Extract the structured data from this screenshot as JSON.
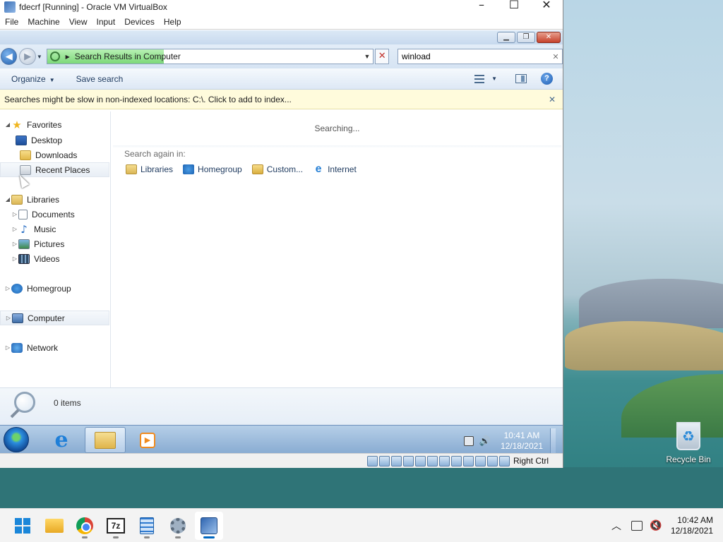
{
  "host": {
    "desktop": {
      "recycle_bin_label": "Recycle Bin"
    },
    "taskbar": {
      "apps": [
        "start-icon",
        "file-explorer-icon",
        "chrome-icon",
        "7zip-icon",
        "notepad-icon",
        "settings-icon",
        "virtualbox-icon"
      ],
      "tray": {
        "time": "10:42 AM",
        "date": "12/18/2021"
      }
    }
  },
  "vbox": {
    "title": "fdecrf [Running] - Oracle VM VirtualBox",
    "menu": [
      "File",
      "Machine",
      "View",
      "Input",
      "Devices",
      "Help"
    ],
    "status": {
      "host_key": "Right Ctrl"
    }
  },
  "explorer": {
    "address": {
      "location": "Search Results in Computer"
    },
    "search": {
      "value": "winload"
    },
    "commands": {
      "organize": "Organize",
      "save_search": "Save search"
    },
    "infobar": {
      "message": "Searches might be slow in non-indexed locations: C:\\. Click to add to index..."
    },
    "nav": {
      "favorites": "Favorites",
      "desktop": "Desktop",
      "downloads": "Downloads",
      "recent_places": "Recent Places",
      "libraries": "Libraries",
      "documents": "Documents",
      "music": "Music",
      "pictures": "Pictures",
      "videos": "Videos",
      "homegroup": "Homegroup",
      "computer": "Computer",
      "network": "Network"
    },
    "content": {
      "status": "Searching...",
      "search_again_label": "Search again in:",
      "search_again": [
        "Libraries",
        "Homegroup",
        "Custom...",
        "Internet"
      ]
    },
    "details": {
      "count": "0 items"
    }
  },
  "guest_taskbar": {
    "clock": {
      "time": "10:41 AM",
      "date": "12/18/2021"
    }
  }
}
